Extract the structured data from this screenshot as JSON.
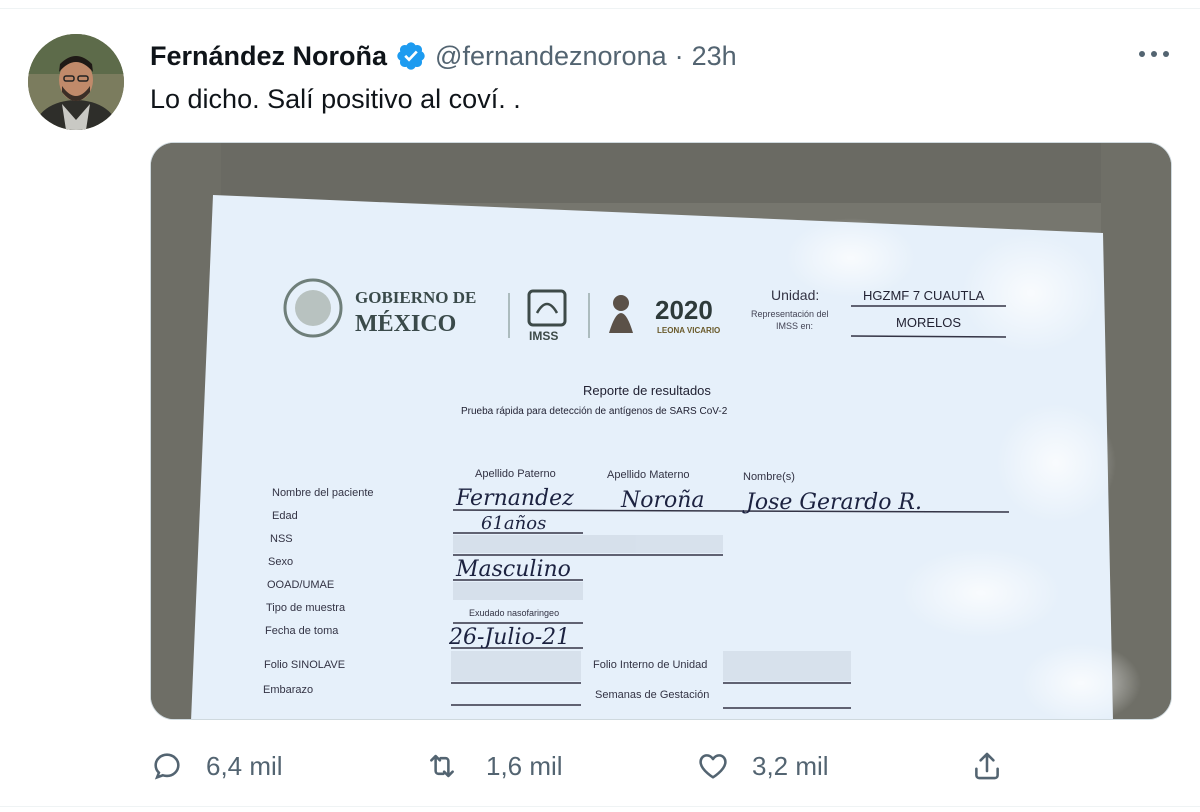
{
  "tweet": {
    "display_name": "Fernández Noroña",
    "handle": "@fernandeznorona",
    "separator": "·",
    "time": "23h",
    "text": "Lo dicho. Salí positivo al coví. ."
  },
  "icons": {
    "verified": "verified-badge-icon",
    "more": "more-dots-icon",
    "reply": "reply-bubble-icon",
    "retweet": "retweet-icon",
    "like": "heart-icon",
    "share": "share-upload-icon"
  },
  "colors": {
    "brand_blue": "#1d9bf0",
    "text_primary": "#0f1419",
    "text_secondary": "#536471"
  },
  "actions": {
    "replies": "6,4 mil",
    "retweets": "1,6 mil",
    "likes": "3,2 mil"
  },
  "document": {
    "gov_line1": "GOBIERNO DE",
    "gov_line2": "MÉXICO",
    "imss": "IMSS",
    "year": "2020",
    "year_sub": "LEONA VICARIO",
    "unidad_label": "Unidad:",
    "unidad_value": "HGZMF 7 CUAUTLA",
    "representacion_label_1": "Representación del",
    "representacion_label_2": "IMSS en:",
    "representacion_value": "MORELOS",
    "title": "Reporte de resultados",
    "subtitle": "Prueba rápida para detección de antígenos de SARS CoV-2",
    "col_paterno": "Apellido Paterno",
    "col_materno": "Apellido Materno",
    "col_nombres": "Nombre(s)",
    "labels": {
      "nombre": "Nombre del paciente",
      "edad": "Edad",
      "nss": "NSS",
      "sexo": "Sexo",
      "ooad": "OOAD/UMAE",
      "tipo": "Tipo de muestra",
      "fecha": "Fecha de toma",
      "folio": "Folio SINOLAVE",
      "embarazo": "Embarazo",
      "folio_interno": "Folio Interno de Unidad",
      "semanas": "Semanas de Gestación"
    },
    "values": {
      "paterno": "Fernandez",
      "materno": "Noroña",
      "nombres": "Jose Gerardo R.",
      "edad": "61años",
      "sexo": "Masculino",
      "tipo": "Exudado nasofaringeo",
      "fecha": "26-Julio-21"
    }
  }
}
